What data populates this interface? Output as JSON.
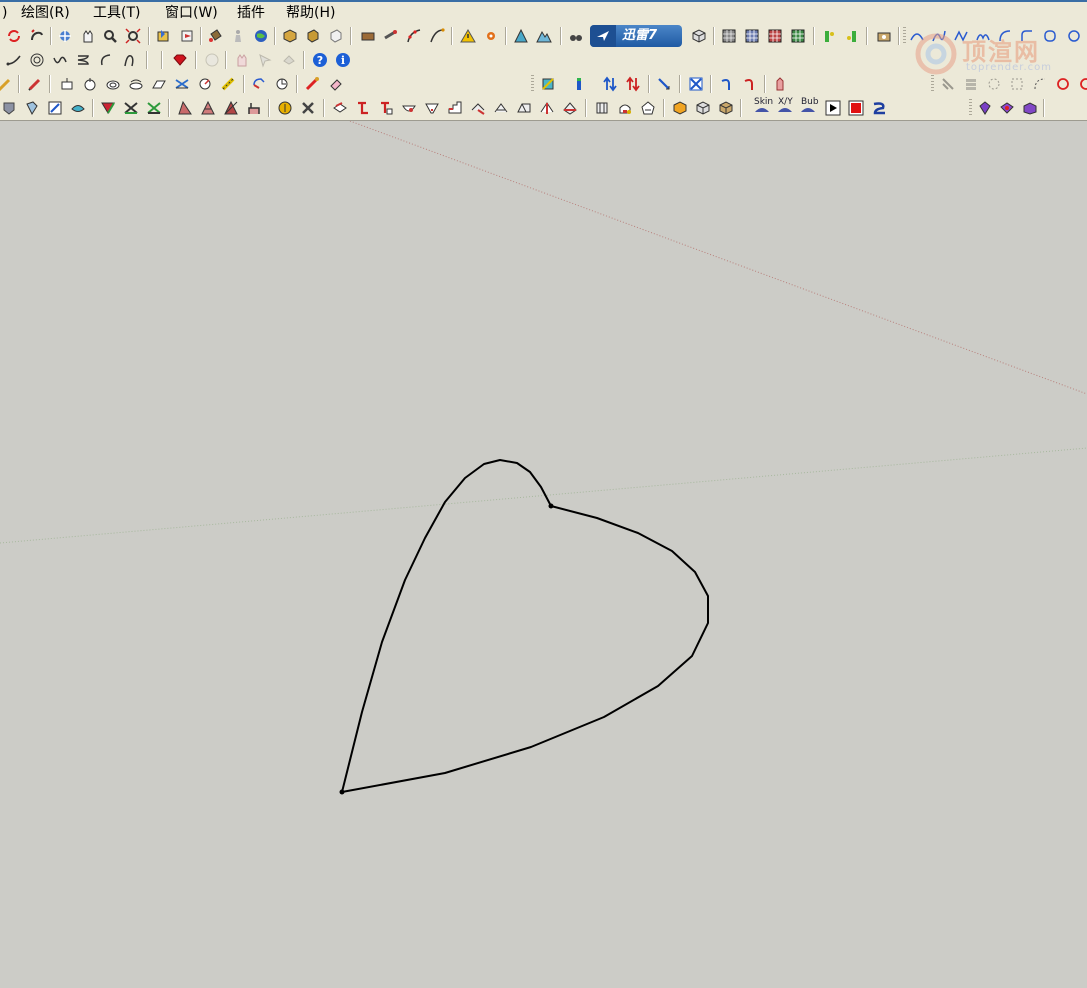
{
  "menu": {
    "items": [
      {
        "label": ")",
        "name": "menu-prev-partial"
      },
      {
        "label": "绘图(R)",
        "name": "menu-draw"
      },
      {
        "label": "工具(T)",
        "name": "menu-tools"
      },
      {
        "label": "窗口(W)",
        "name": "menu-window"
      },
      {
        "label": "插件",
        "name": "menu-plugins"
      },
      {
        "label": "帮助(H)",
        "name": "menu-help"
      }
    ]
  },
  "xunlei": {
    "label": "迅雷7"
  },
  "watermark": {
    "title": "顶渲网",
    "subtitle": "toprender.com"
  },
  "toolbar": {
    "skin_label": "Skin",
    "xy_label": "X/Y",
    "bub_label": "Bub"
  },
  "colors": {
    "accent": "#1f5aa3",
    "background": "#ccccc7",
    "toolbar": "#ece9d8"
  }
}
